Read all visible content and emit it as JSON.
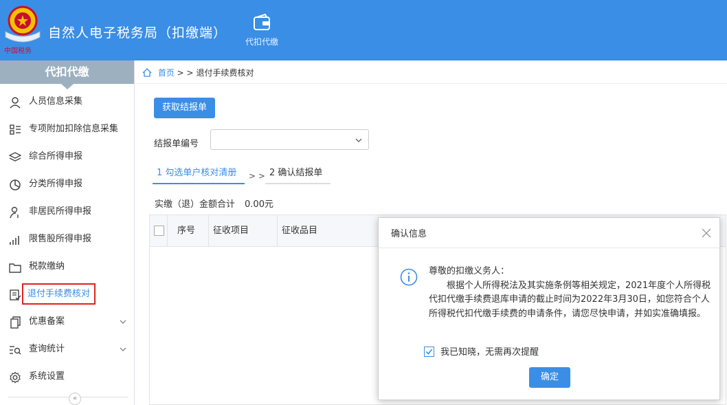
{
  "header": {
    "app_title": "自然人电子税务局（扣缴端）",
    "emblem_text": "中国税务",
    "top_nav_label": "代扣代缴",
    "brand_color": "#3a8ee6"
  },
  "sidebar": {
    "title": "代扣代缴",
    "items": [
      {
        "label": "人员信息采集",
        "icon": "person-icon"
      },
      {
        "label": "专项附加扣除信息采集",
        "icon": "list-icon"
      },
      {
        "label": "综合所得申报",
        "icon": "layers-icon"
      },
      {
        "label": "分类所得申报",
        "icon": "pie-icon"
      },
      {
        "label": "非居民所得申报",
        "icon": "person-outline-icon"
      },
      {
        "label": "限售股所得申报",
        "icon": "bar-chart-icon"
      },
      {
        "label": "税款缴纳",
        "icon": "folder-icon"
      },
      {
        "label": "退付手续费核对",
        "icon": "document-check-icon",
        "active": true
      },
      {
        "label": "优惠备案",
        "icon": "copy-icon",
        "expandable": true
      },
      {
        "label": "查询统计",
        "icon": "search-list-icon",
        "expandable": true
      },
      {
        "label": "系统设置",
        "icon": "gear-icon"
      }
    ]
  },
  "breadcrumb": {
    "home": "首页",
    "separator": "> >",
    "current": "退付手续费核对"
  },
  "main": {
    "fetch_button": "获取结报单",
    "report_no_label": "结报单编号",
    "report_no_value": "",
    "steps": [
      {
        "label": "1 勾选单户核对清册",
        "active": true
      },
      {
        "label": "2 确认结报单",
        "active": false
      }
    ],
    "step_separator": "> >",
    "total_label": "实缴（退）金额合计",
    "total_value": "0.00元",
    "table_headers": [
      "序号",
      "征收项目",
      "征收品目"
    ]
  },
  "dialog": {
    "title": "确认信息",
    "greeting": "尊敬的扣缴义务人：",
    "message": "根据个人所得税法及其实施条例等相关规定，2021年度个人所得税代扣代缴手续费退库申请的截止时间为2022年3月30日，如您符合个人所得税代扣代缴手续费的申请条件，请您尽快申请，并如实准确填报。",
    "checkbox_label": "我已知晓，无需再次提醒",
    "checkbox_checked": true,
    "ok_button": "确定"
  }
}
